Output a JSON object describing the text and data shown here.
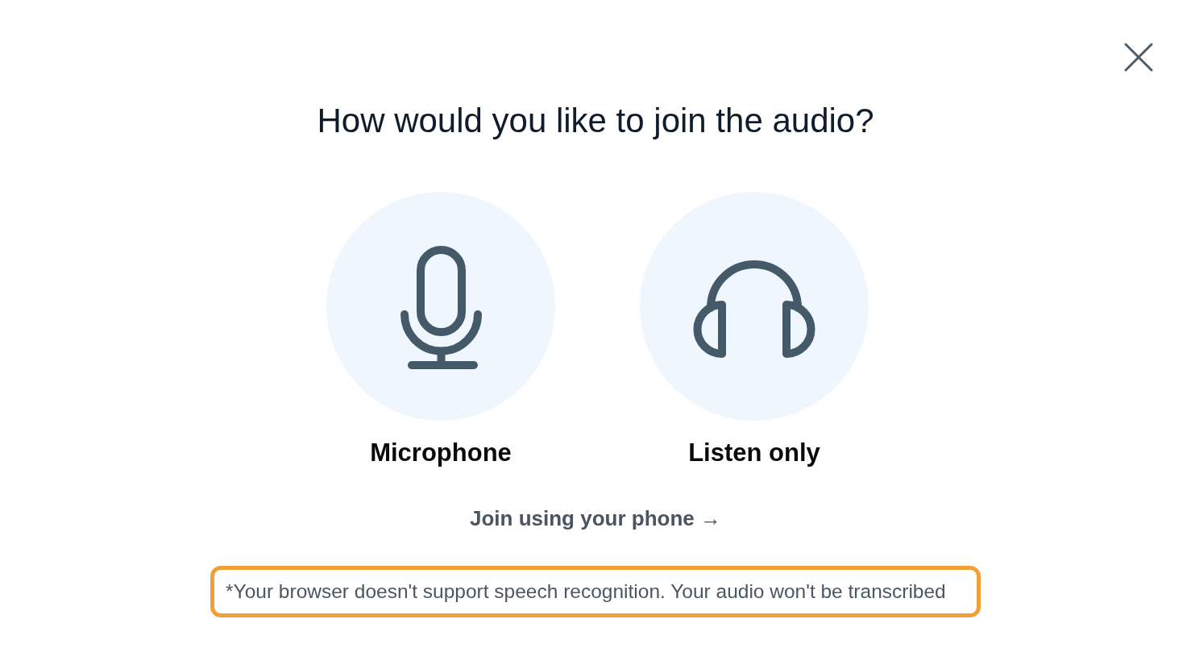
{
  "dialog": {
    "title": "How would you like to join the audio?",
    "options": [
      {
        "kind": "microphone",
        "label": "Microphone"
      },
      {
        "kind": "headphones",
        "label": "Listen only"
      }
    ],
    "phone_link": "Join using your phone →",
    "notice": "*Your browser doesn't support speech recognition. Your audio won't be transcribed"
  }
}
